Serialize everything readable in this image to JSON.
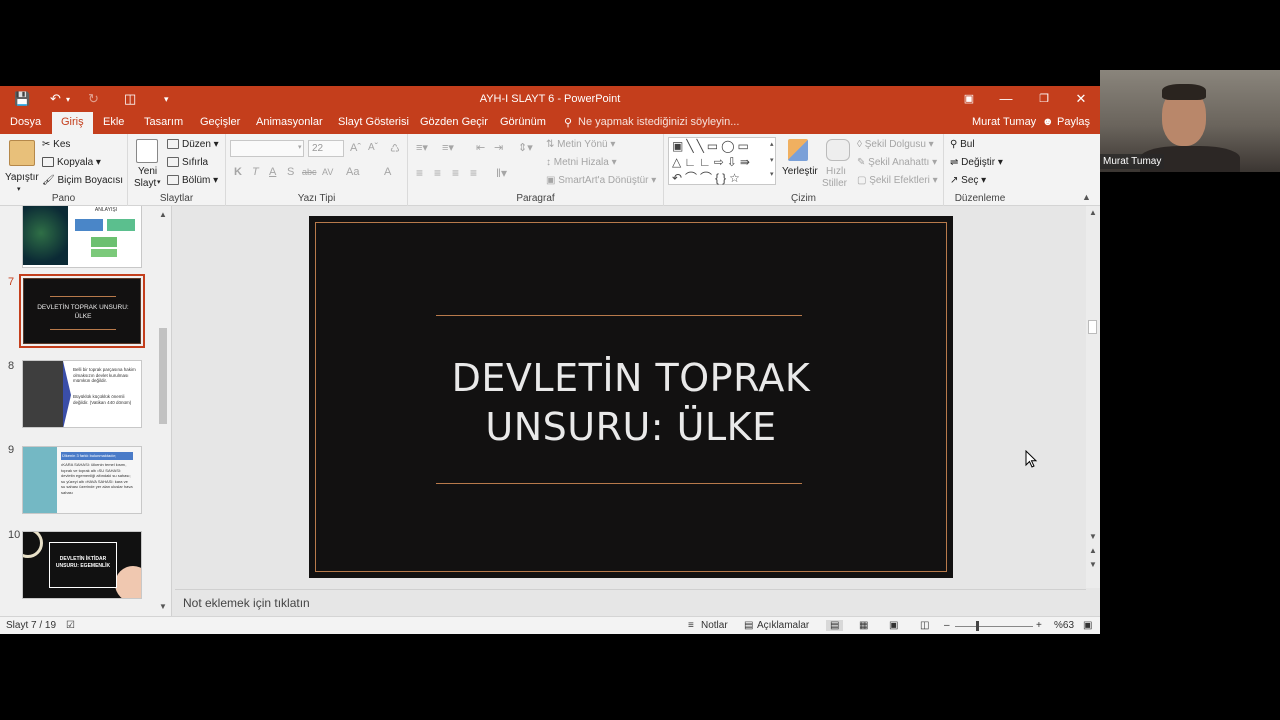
{
  "titlebar": {
    "title": "AYH-I SLAYT 6 - PowerPoint",
    "account_name": "Murat Tumay",
    "share_label": "Paylaş"
  },
  "tabs": [
    "Dosya",
    "Giriş",
    "Ekle",
    "Tasarım",
    "Geçişler",
    "Animasyonlar",
    "Slayt Gösterisi",
    "Gözden Geçir",
    "Görünüm"
  ],
  "active_tab": "Giriş",
  "tell_me": "Ne yapmak istediğinizi söyleyin...",
  "ribbon": {
    "pano": {
      "label": "Pano",
      "paste": "Yapıştır",
      "cut": "Kes",
      "copy": "Kopyala",
      "format_painter": "Biçim Boyacısı"
    },
    "slaytlar": {
      "label": "Slaytlar",
      "new_slide_1": "Yeni",
      "new_slide_2": "Slayt",
      "layout": "Düzen",
      "reset": "Sıfırla",
      "section": "Bölüm"
    },
    "yazi_tipi": {
      "label": "Yazı Tipi",
      "font_name": "",
      "font_size": "22",
      "bold": "K",
      "italic": "T",
      "underline": "A",
      "shadow": "S",
      "strike": "abc",
      "spacing": "AV",
      "case": "Aa",
      "color": "A"
    },
    "paragraf": {
      "label": "Paragraf",
      "text_direction": "Metin Yönü",
      "align_text": "Metni Hizala",
      "smartart": "SmartArt'a Dönüştür"
    },
    "cizim": {
      "label": "Çizim",
      "arrange": "Yerleştir",
      "quick_styles_1": "Hızlı",
      "quick_styles_2": "Stiller",
      "shape_fill": "Şekil Dolgusu",
      "shape_outline": "Şekil Anahattı",
      "shape_effects": "Şekil Efektleri"
    },
    "duzenleme": {
      "label": "Düzenleme",
      "find": "Bul",
      "replace": "Değiştir",
      "select": "Seç"
    }
  },
  "thumbnails": [
    {
      "number": "",
      "title": "ANLAYIŞI"
    },
    {
      "number": "7",
      "title": "DEVLETİN TOPRAK UNSURU: ÜLKE",
      "selected": true
    },
    {
      "number": "8",
      "text1": "Belli bir toprak parçasına hakim olmaksızın devlet kurulması mümkün değildir.",
      "text2": "Büyüklük küçüklük önemli değildir. (Vatikan 440 dönüm)"
    },
    {
      "number": "9",
      "header": "Ülkenin 3 farklı bulunmaktadır;",
      "text": "•KARA SAHASI: ülkenin temel kısmı, toprak ve toprak altı •SU SAHASI: devletin egemenliği altındaki su sahası; su yüzeyi altı •HAVA SAHASI: kara ve su sahası üzerinde yer alan uluslar hava sahası"
    },
    {
      "number": "10",
      "title": "DEVLETİN İKTİDAR UNSURU: EGEMENLİK"
    }
  ],
  "slide": {
    "title_line1": "DEVLETİN TOPRAK",
    "title_line2": "UNSURU: ÜLKE"
  },
  "notes_placeholder": "Not eklemek için tıklatın",
  "status": {
    "slide_count": "Slayt 7 / 19",
    "notes_button": "Notlar",
    "comments_button": "Açıklamalar",
    "zoom": "%63"
  },
  "webcam": {
    "name": "Murat Tumay"
  },
  "colors": {
    "accent": "#c43e1c",
    "slide_bg": "#121111",
    "slide_line": "#b87a4b"
  }
}
